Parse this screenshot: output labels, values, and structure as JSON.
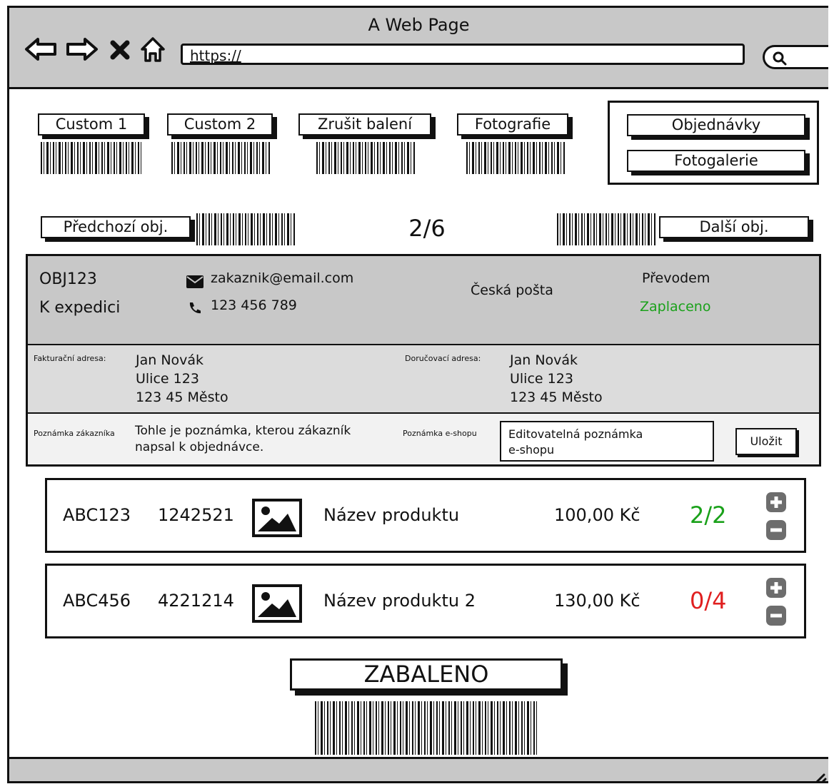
{
  "browser": {
    "title": "A Web Page",
    "url": "https://"
  },
  "actions": {
    "custom1": "Custom 1",
    "custom2": "Custom 2",
    "cancel_packing": "Zrušit balení",
    "photos": "Fotografie",
    "orders": "Objednávky",
    "gallery": "Fotogalerie"
  },
  "pager": {
    "prev": "Předchozí obj.",
    "counter": "2/6",
    "next": "Další obj."
  },
  "order": {
    "id": "OBJ123",
    "status": "K expedici",
    "email": "zakaznik@email.com",
    "phone": "123 456 789",
    "carrier": "Česká pošta",
    "payment_method": "Převodem",
    "payment_status": "Zaplaceno",
    "billing_label": "Fakturační adresa:",
    "billing_lines": [
      "Jan Novák",
      "Ulice 123",
      "123 45 Město"
    ],
    "delivery_label": "Doručovací adresa:",
    "delivery_lines": [
      "Jan Novák",
      "Ulice 123",
      "123 45 Město"
    ],
    "customer_note_label": "Poznámka zákazníka",
    "customer_note_lines": [
      "Tohle je poznámka, kterou zákazník",
      "napsal k objednávce."
    ],
    "shop_note_label": "Poznámka e-shopu",
    "shop_note_lines": [
      "Editovatelná poznámka",
      "e-shopu"
    ],
    "save": "Uložit"
  },
  "products": [
    {
      "code": "ABC123",
      "ean": "1242521",
      "name": "Název produktu",
      "price": "100,00 Kč",
      "qty": "2/2",
      "qty_color": "#1aa11a"
    },
    {
      "code": "ABC456",
      "ean": "4221214",
      "name": "Název produktu 2",
      "price": "130,00 Kč",
      "qty": "0/4",
      "qty_color": "#e02020"
    }
  ],
  "packed_button": "ZABALENO"
}
